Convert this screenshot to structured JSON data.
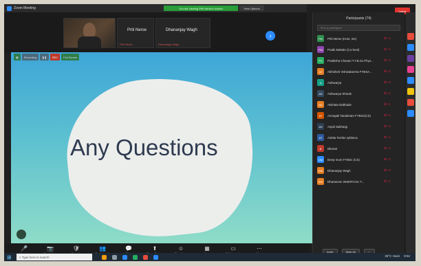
{
  "window": {
    "title": "Zoom Meeting",
    "share_banner": "You are viewing Priti Nerse's screen",
    "view_options": "View Options"
  },
  "video_strip": {
    "tiles": [
      {
        "name": "",
        "sub": ""
      },
      {
        "name": "Priti Nerse",
        "sub": "Priti Nerse"
      },
      {
        "name": "Dhananjay Wagh",
        "sub": "Dhananjay Wagh"
      }
    ]
  },
  "share_toolbar": {
    "recording": "Recording",
    "rec": "REC",
    "full": "Full Screen"
  },
  "slide": {
    "text": "Any Questions"
  },
  "controls": [
    {
      "label": "Unmute",
      "icon": "mic-icon",
      "glyph": "🎤"
    },
    {
      "label": "Start Video",
      "icon": "camera-icon",
      "glyph": "📷"
    },
    {
      "label": "Security",
      "icon": "shield-icon",
      "glyph": "🛡"
    },
    {
      "label": "Participants",
      "icon": "people-icon",
      "glyph": "👥"
    },
    {
      "label": "Chat",
      "icon": "chat-icon",
      "glyph": "💬"
    },
    {
      "label": "Share Screen",
      "icon": "share-icon",
      "glyph": "⬆"
    },
    {
      "label": "Reactions",
      "icon": "smile-icon",
      "glyph": "☺"
    },
    {
      "label": "Apps",
      "icon": "apps-icon",
      "glyph": "▦"
    },
    {
      "label": "Whiteboards",
      "icon": "whiteboard-icon",
      "glyph": "▭"
    },
    {
      "label": "More",
      "icon": "more-icon",
      "glyph": "⋯"
    }
  ],
  "end_label": "Leave",
  "panel": {
    "title": "Participants (74)",
    "search_placeholder": "Find a participant",
    "participants": [
      {
        "initials": "PN",
        "name": "Priti Nerse (Host, me)",
        "color": "#2f8f4e"
      },
      {
        "initials": "PM",
        "name": "Pratik Mahale (Co-host)",
        "color": "#8e44ad"
      },
      {
        "initials": "PC",
        "name": "Pratiksha Chavan T.Y.B.Sc.Phys...",
        "color": "#27ae60"
      },
      {
        "initials": "AV",
        "name": "Abhishek Vishwakarma FYBSA...",
        "color": "#e67e22"
      },
      {
        "initials": "A",
        "name": "Aishwarya",
        "color": "#16a085"
      },
      {
        "initials": "AS",
        "name": "Aishwarya Shinde",
        "color": "#34495e"
      },
      {
        "initials": "AD",
        "name": "Akshata Dabhade",
        "color": "#e67e22"
      },
      {
        "initials": "AT",
        "name": "Amrapali Tanalmare FYBSc(CS)",
        "color": "#d35400"
      },
      {
        "initials": "AS",
        "name": "Anjali Sakhargi",
        "color": "#2c3e50"
      },
      {
        "initials": "AT",
        "name": "Ankita Tembe sybbsca",
        "color": "#2c5aa0"
      },
      {
        "initials": "B",
        "name": "Bharati",
        "color": "#c0392b"
      },
      {
        "initials": "DM",
        "name": "Deep more FYBSc (CS)",
        "color": "#2d8cff"
      },
      {
        "initials": "DW",
        "name": "Dhananjay Wagh",
        "color": "#e67e22"
      },
      {
        "initials": "DW",
        "name": "Dharasonn INSERYcSc T...",
        "color": "#e67e22"
      }
    ],
    "invite": "Invite",
    "mute_all": "Mute All"
  },
  "taskbar": {
    "search": "Type here to search",
    "tray_weather": "28°C Haze",
    "time": "8:52"
  }
}
